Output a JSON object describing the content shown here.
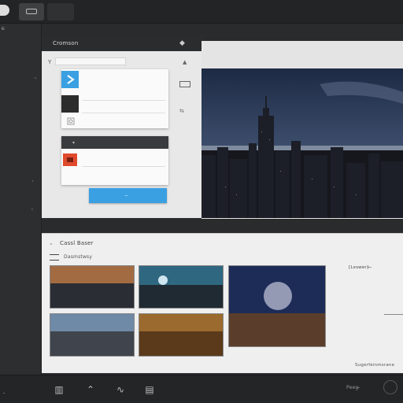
{
  "topbar": {
    "tabs": [
      "",
      "",
      ""
    ]
  },
  "sidebar": {
    "items": [
      "C̶̶̶̶̶̶̶",
      "̶̶̶̶̶̶̶̶",
      "̶̶̶̶̶",
      "̶̶̶̶̶̶̶",
      "̶̶̶̶̶̶",
      "̶̶̶̶̶̶̶̶",
      "̶̶̶̶̶̶̶",
      "̶̶̶̶̶̶",
      "̶̶̶",
      "̶̶̶̶"
    ],
    "footer_label": "̶̶̶̶̶̶ ̶̶̶̶̶"
  },
  "panel_a": {
    "title": "Cromson",
    "search_label": "Y",
    "card_a_rows": [
      "̶̶̶̶̶̶̶̶̶̶̶̶̶̶̶",
      "̶̶̶̶̶̶̶̶̶̶̶̶",
      "̶̶̶̶̶̶̶̶̶̶̶̶̶̶̶̶̶̶",
      "̶̶̶̶̶̶̶̶̶̶̶"
    ],
    "card_b_title": "̶̶̶̶̶̶̶̶̶̶",
    "card_b_rows": [
      "̶̶̶̶̶̶̶̶̶̶̶̶̶̶̶̶",
      "̶̶̶̶̶̶̶̶̶̶̶̶̶̶̶̶̶̶̶̶̶"
    ],
    "apply_label": "̶̶̶̶̶̶̶̶̶̶̶̶̶̶̶̶̶̶̶̶̶"
  },
  "gallery": {
    "title": "Cassl Baser",
    "subtitle": "Dasmstwsy",
    "caption": "̶̶̶̶̶̶̶̶̶̶̶̶̶̶̶̶̶̶̶",
    "info_title": "[Lxswer] ̶̶̶̶̶ ̶̶̶̶̶̶",
    "info_sub": "̶̶̶̶̶̶̶̶̶̶̶̶̶̶̶̶̶̶̶̶̶",
    "info_footer": "Sugerfeinmsrane"
  },
  "bottombar": {
    "right_label": "Peeg ̶̶̶̶̶"
  },
  "colors": {
    "accent": "#3aa0e2",
    "red_thumb": "#e04a2c"
  }
}
